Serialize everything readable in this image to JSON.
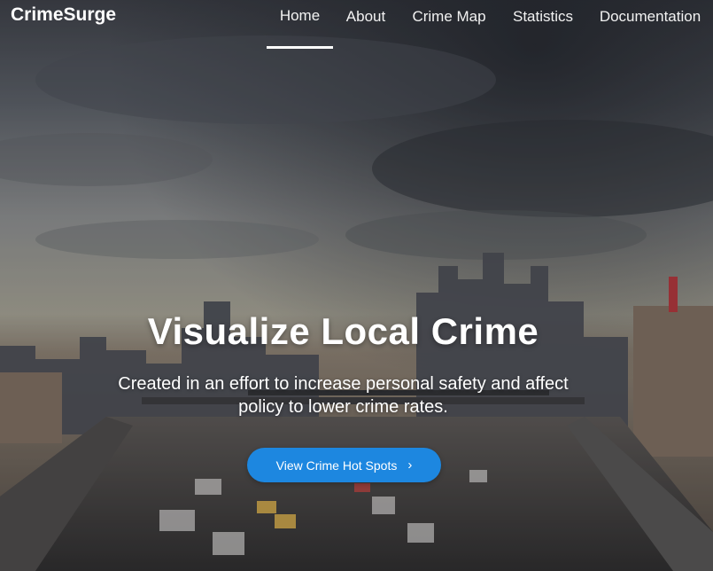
{
  "brand": {
    "name": "CrimeSurge"
  },
  "nav": {
    "items": [
      {
        "label": "Home",
        "active": true
      },
      {
        "label": "About",
        "active": false
      },
      {
        "label": "Crime Map",
        "active": false
      },
      {
        "label": "Statistics",
        "active": false
      },
      {
        "label": "Documentation",
        "active": false
      }
    ]
  },
  "hero": {
    "title": "Visualize Local Crime",
    "subtitle": "Created in an effort to increase personal safety and affect policy to lower crime rates.",
    "cta_label": "View Crime Hot Spots",
    "cta_icon": "chevron-right-icon"
  },
  "colors": {
    "accent": "#1d87e0",
    "text": "#ffffff"
  }
}
